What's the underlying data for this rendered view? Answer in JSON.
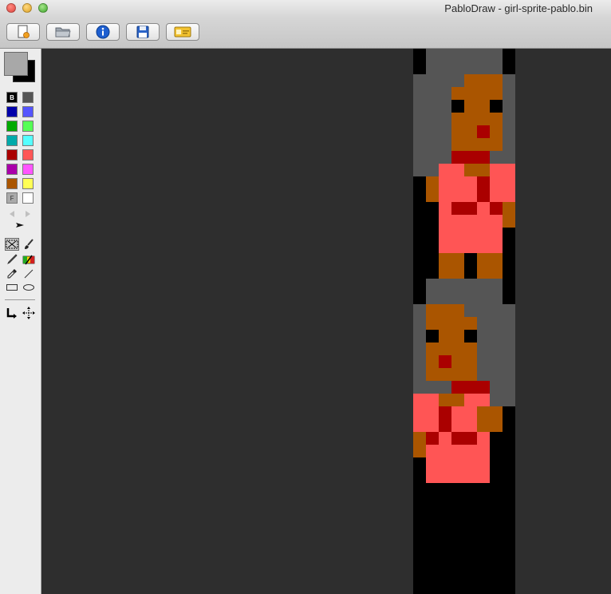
{
  "window": {
    "title": "PabloDraw - girl-sprite-pablo.bin"
  },
  "toolbar": {
    "buttons": [
      {
        "name": "new-file-button",
        "icon": "new-document-icon"
      },
      {
        "name": "open-file-button",
        "icon": "folder-icon"
      },
      {
        "name": "info-button",
        "icon": "info-icon"
      },
      {
        "name": "save-button",
        "icon": "floppy-disk-icon"
      },
      {
        "name": "sauce-button",
        "icon": "id-card-icon"
      }
    ]
  },
  "palette": {
    "foreground": "#a8a8a8",
    "background": "#000000",
    "swatches": [
      "#000000",
      "#555555",
      "#0000aa",
      "#5555ff",
      "#00aa00",
      "#55ff55",
      "#00aaaa",
      "#55ffff",
      "#aa0000",
      "#ff5555",
      "#aa00aa",
      "#ff55ff",
      "#aa5500",
      "#ffff55",
      "#aaaaaa",
      "#ffffff"
    ],
    "labels": {
      "background": "B",
      "foreground": "F"
    }
  },
  "tools": [
    "selection-tool-icon",
    "brush-icon",
    "pencil-icon",
    "color-brush-icon",
    "eyedropper-icon",
    "line-icon",
    "rectangle-icon",
    "ellipse-icon",
    "cursor-direction-icon",
    "move-icon"
  ],
  "art_colors": {
    "black": "#000000",
    "gray": "#555555",
    "brown": "#aa5500",
    "red": "#aa0000",
    "pink": "#ff5555"
  }
}
